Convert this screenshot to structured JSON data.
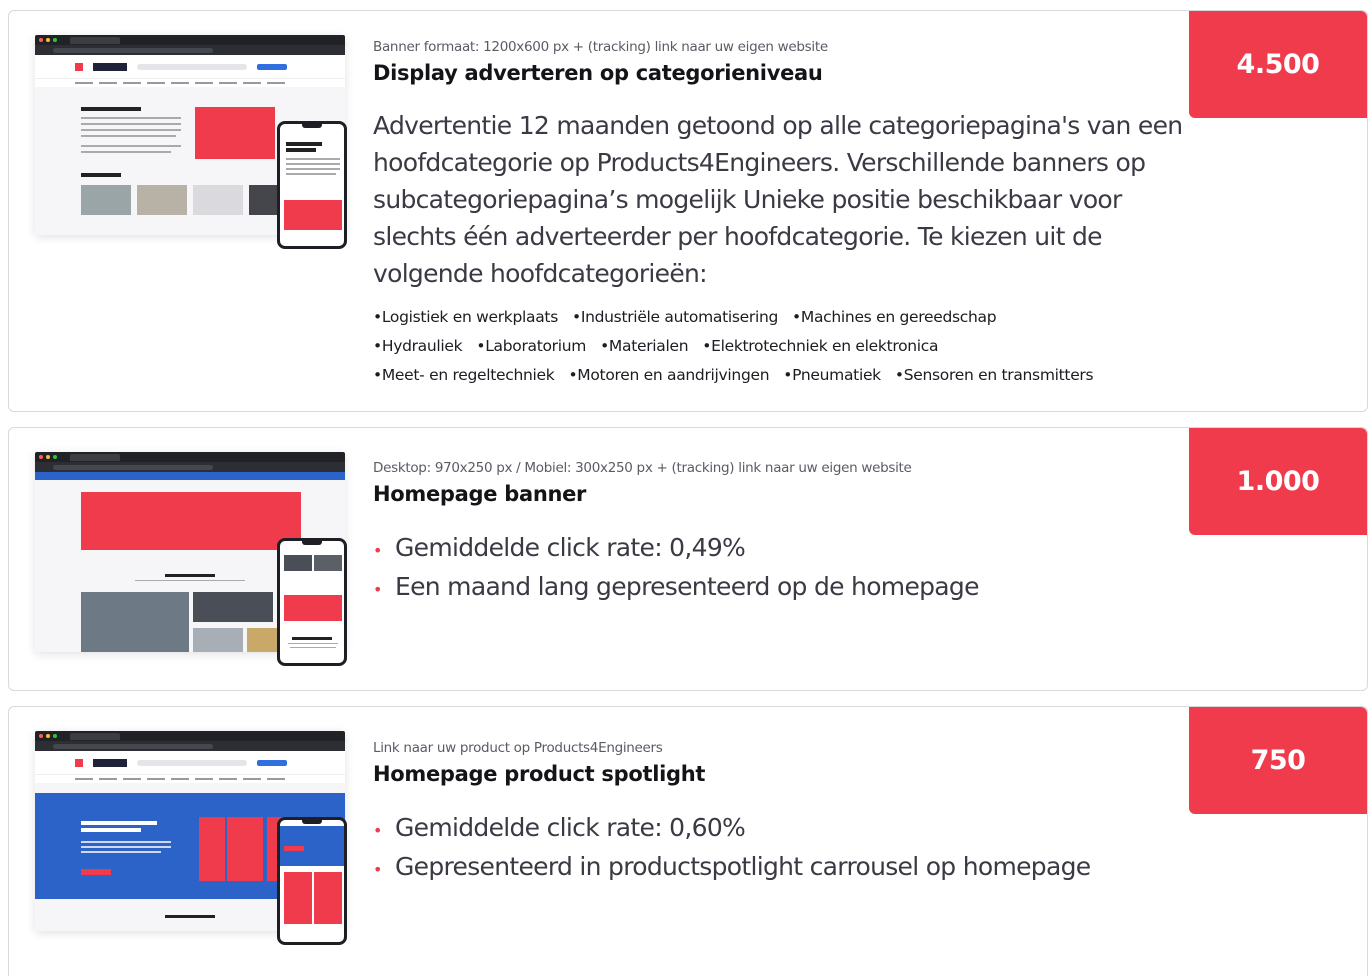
{
  "cards": [
    {
      "subtitle": "Banner formaat: 1200x600 px + (tracking) link naar uw eigen website",
      "title": "Display adverteren op categorieniveau",
      "price": "4.500",
      "description": "Advertentie 12 maanden getoond op alle categoriepagina's van een hoofdcategorie op Products4Engineers. Verschillende banners op subcategoriepagina’s mogelijk Unieke positie beschikbaar voor slechts één adverteerder per hoofdcategorie. Te kiezen uit de volgende hoofdcategorieën:",
      "categories": [
        [
          "Logistiek en werkplaats",
          "Industriële automatisering",
          "Machines en gereedschap"
        ],
        [
          "Hydrauliek",
          "Laboratorium",
          "Materialen",
          "Elektrotechniek en elektronica"
        ],
        [
          "Meet- en regeltechniek",
          "Motoren en aandrijvingen",
          "Pneumatiek",
          "Sensoren en transmitters"
        ]
      ]
    },
    {
      "subtitle": "Desktop: 970x250 px / Mobiel: 300x250 px + (tracking) link naar uw eigen website",
      "title": "Homepage banner",
      "price": "1.000",
      "bullets": [
        "Gemiddelde click rate: 0,49%",
        "Een maand lang gepresenteerd op de homepage"
      ]
    },
    {
      "subtitle": "Link naar uw product op Products4Engineers",
      "title": "Homepage product spotlight",
      "price": "750",
      "bullets": [
        "Gemiddelde click rate: 0,60%",
        "Gepresenteerd in productspotlight carrousel op homepage"
      ]
    }
  ],
  "colors": {
    "accent": "#ef3b4c",
    "hero_blue": "#2c63c8",
    "text": "#1c1c22"
  }
}
